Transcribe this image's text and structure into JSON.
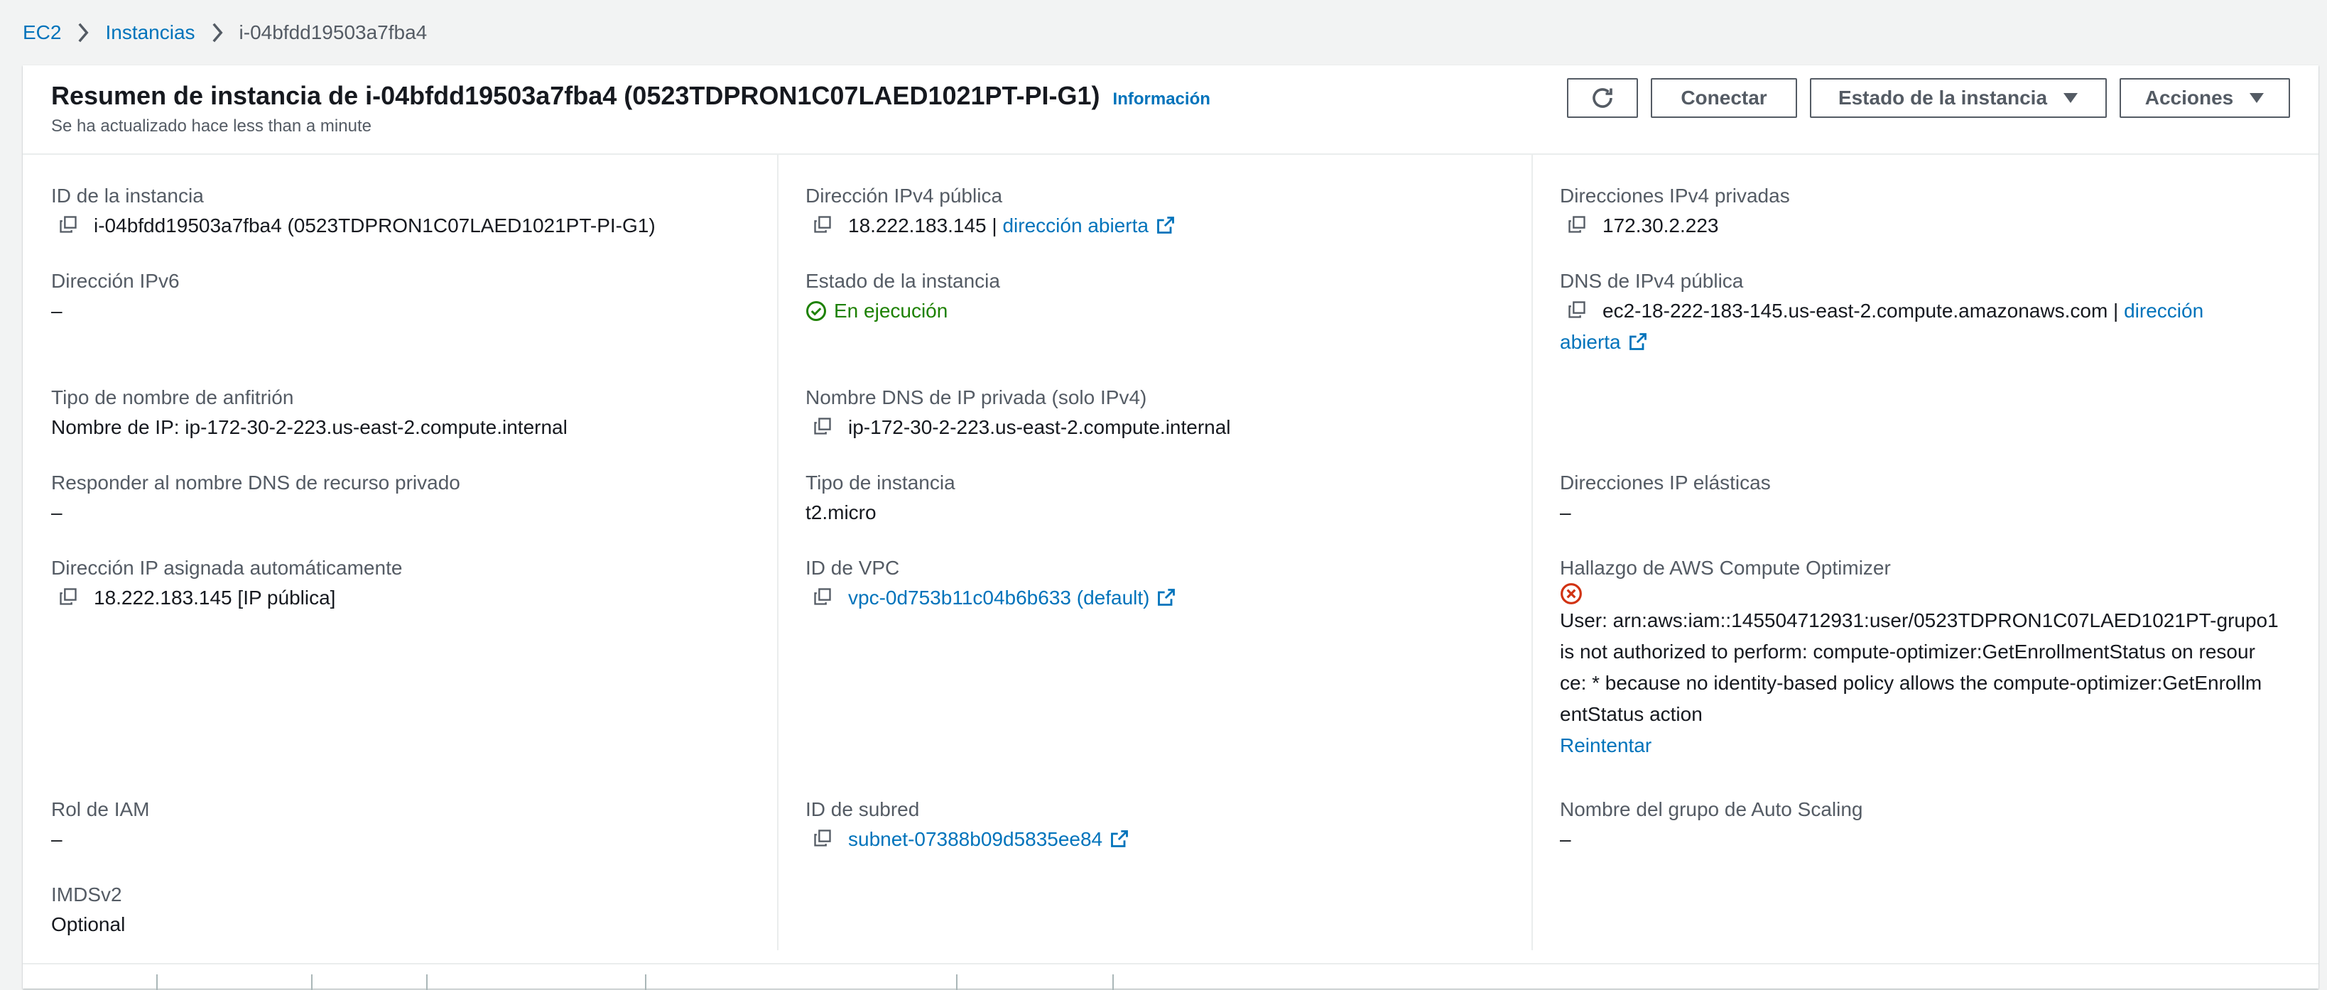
{
  "breadcrumb": {
    "items": [
      "EC2",
      "Instancias"
    ],
    "current": "i-04bfdd19503a7fba4"
  },
  "header": {
    "title": "Resumen de instancia de i-04bfdd19503a7fba4 (0523TDPRON1C07LAED1021PT-PI-G1)",
    "info": "Información",
    "subtitle": "Se ha actualizado hace less than a minute",
    "buttons": {
      "connect": "Conectar",
      "instance_state": "Estado de la instancia",
      "actions": "Acciones"
    }
  },
  "details": {
    "instance_id": {
      "label": "ID de la instancia",
      "value": "i-04bfdd19503a7fba4 (0523TDPRON1C07LAED1021PT-PI-G1)"
    },
    "public_ipv4": {
      "label": "Dirección IPv4 pública",
      "value": "18.222.183.145",
      "sep": " | ",
      "link": "dirección abierta"
    },
    "private_ipv4": {
      "label": "Direcciones IPv4 privadas",
      "value": "172.30.2.223"
    },
    "ipv6": {
      "label": "Dirección IPv6",
      "value": "–"
    },
    "instance_state": {
      "label": "Estado de la instancia",
      "value": "En ejecución"
    },
    "public_dns": {
      "label": "DNS de IPv4 pública",
      "value": "ec2-18-222-183-145.us-east-2.compute.amazonaws.com",
      "sep": " | ",
      "link1": "dirección",
      "link2": "abierta"
    },
    "hostname_type": {
      "label": "Tipo de nombre de anfitrión",
      "value": "Nombre de IP: ip-172-30-2-223.us-east-2.compute.internal"
    },
    "private_dns": {
      "label": "Nombre DNS de IP privada (solo IPv4)",
      "value": "ip-172-30-2-223.us-east-2.compute.internal"
    },
    "answer_dns": {
      "label": "Responder al nombre DNS de recurso privado",
      "value": "–"
    },
    "instance_type": {
      "label": "Tipo de instancia",
      "value": "t2.micro"
    },
    "elastic_ips": {
      "label": "Direcciones IP elásticas",
      "value": "–"
    },
    "auto_ip": {
      "label": "Dirección IP asignada automáticamente",
      "value": "18.222.183.145 [IP pública]"
    },
    "vpc": {
      "label": "ID de VPC",
      "value": "vpc-0d753b11c04b6b633 (default)"
    },
    "optimizer": {
      "label": "Hallazgo de AWS Compute Optimizer",
      "line1": "User: arn:aws:iam::145504712931:user/0523TDPRON1C07LAED1021PT-grupo1",
      "line2": "is not authorized to perform: compute-optimizer:GetEnrollmentStatus on resour",
      "line3": "ce: * because no identity-based policy allows the compute-optimizer:GetEnrollm",
      "line4": "entStatus action",
      "retry": "Reintentar"
    },
    "iam_role": {
      "label": "Rol de IAM",
      "value": "–"
    },
    "subnet": {
      "label": "ID de subred",
      "value": "subnet-07388b09d5835ee84"
    },
    "asg": {
      "label": "Nombre del grupo de Auto Scaling",
      "value": "–"
    },
    "imdsv2": {
      "label": "IMDSv2",
      "value": "Optional"
    }
  },
  "colors": {
    "link": "#0073bb",
    "running": "#1d8102",
    "error": "#d13212"
  }
}
